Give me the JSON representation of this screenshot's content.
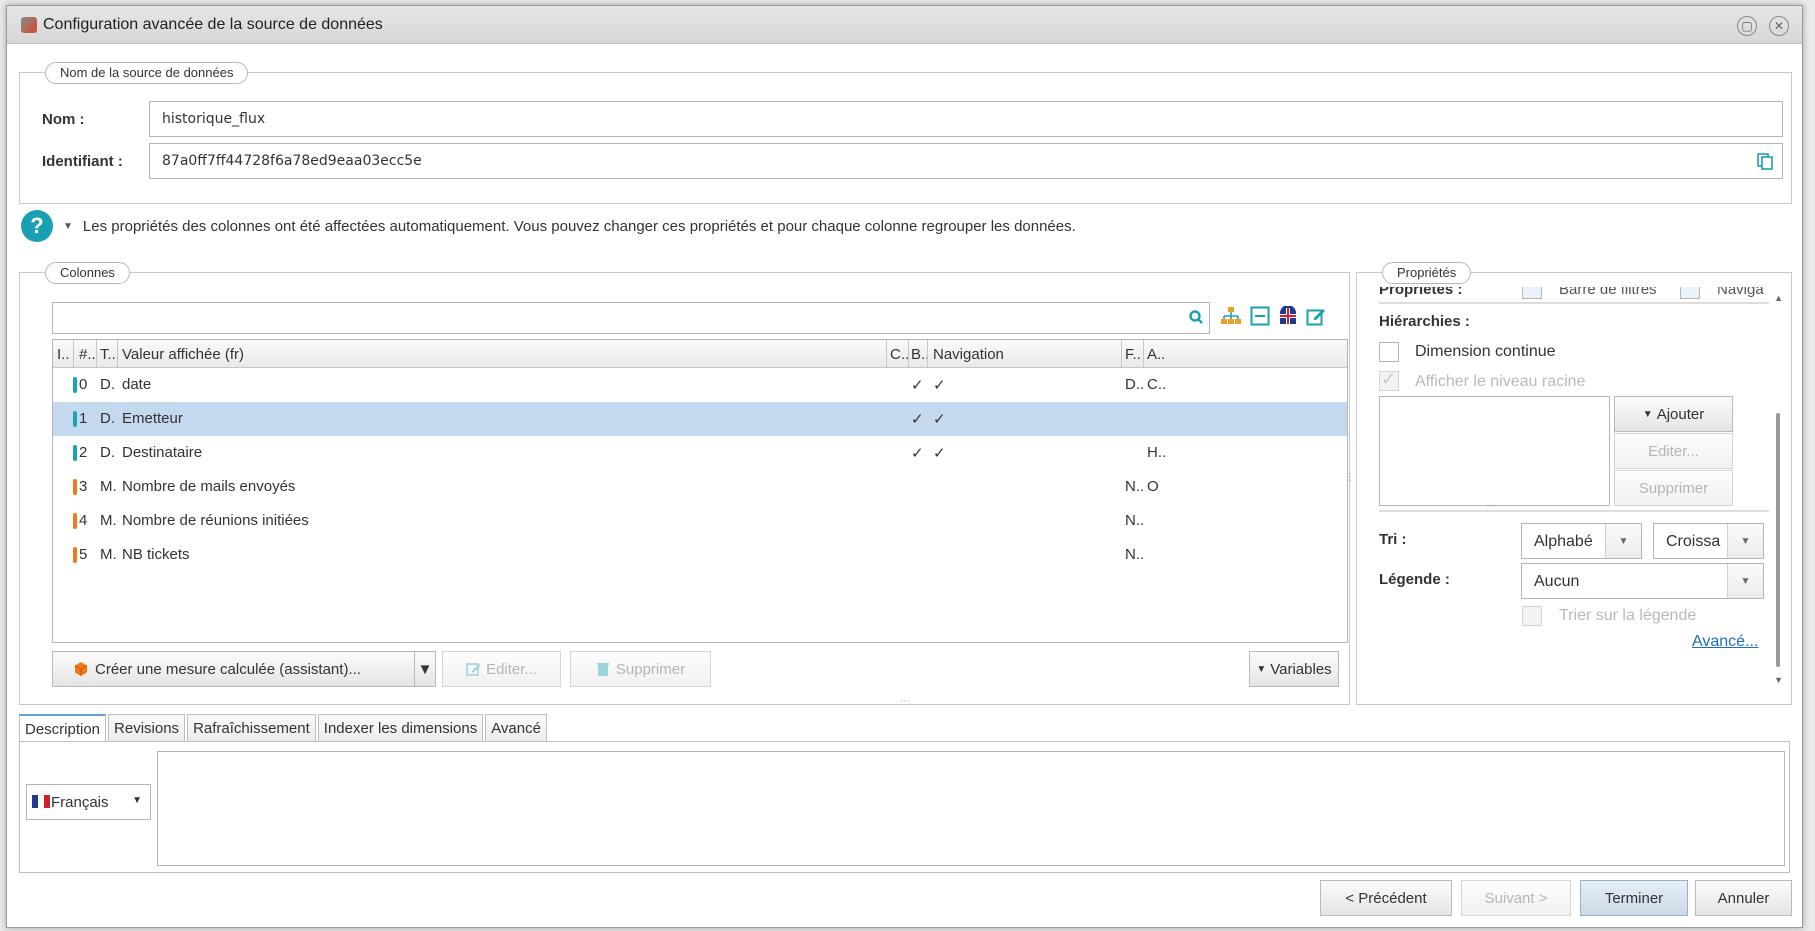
{
  "dialog": {
    "title": "Configuration avancée de la source de données"
  },
  "source_name": {
    "legend": "Nom de la source de données",
    "name_label": "Nom :",
    "name_value": "historique_flux",
    "id_label": "Identifiant :",
    "id_value": "87a0ff7ff44728f6a78ed9eaa03ecc5e"
  },
  "info": {
    "text": "Les propriétés des colonnes ont été affectées automatiquement. Vous pouvez changer ces propriétés et pour chaque colonne regrouper les données."
  },
  "columns": {
    "legend": "Colonnes",
    "headers": [
      "I..",
      "#..",
      "T..",
      "Valeur affichée (fr)",
      "C..",
      "B..",
      "Navigation",
      "F..",
      "A.."
    ],
    "rows": [
      {
        "num": "0",
        "type": "D.",
        "value": "date",
        "b": "✓",
        "nav": "✓",
        "f": "D..",
        "a": "C..",
        "color": "#1aa6b0"
      },
      {
        "num": "1",
        "type": "D.",
        "value": "Emetteur",
        "b": "✓",
        "nav": "✓",
        "f": "",
        "a": "",
        "color": "#1aa6b0"
      },
      {
        "num": "2",
        "type": "D.",
        "value": "Destinataire",
        "b": "✓",
        "nav": "✓",
        "f": "",
        "a": "H..",
        "color": "#1aa6b0"
      },
      {
        "num": "3",
        "type": "M.",
        "value": "Nombre de mails envoyés",
        "b": "",
        "nav": "",
        "f": "N..",
        "a": "O",
        "color": "#f07a1a"
      },
      {
        "num": "4",
        "type": "M.",
        "value": "Nombre de réunions initiées",
        "b": "",
        "nav": "",
        "f": "N..",
        "a": "",
        "color": "#f07a1a"
      },
      {
        "num": "5",
        "type": "M.",
        "value": "NB tickets",
        "b": "",
        "nav": "",
        "f": "N..",
        "a": "",
        "color": "#f07a1a"
      }
    ],
    "create_button": "Créer une mesure calculée (assistant)...",
    "edit_button": "Editer...",
    "delete_button": "Supprimer",
    "variables_button": "Variables"
  },
  "properties": {
    "legend": "Propriétés",
    "top_cut_label": "Propriétés :",
    "filter_bar": "Barre de filtres",
    "navigation": "Naviga",
    "hierarchies_label": "Hiérarchies :",
    "continuous_dimension": "Dimension continue",
    "show_root_level": "Afficher le niveau racine",
    "add_button": "Ajouter",
    "edit_button": "Editer...",
    "delete_button": "Supprimer",
    "sort_label": "Tri :",
    "sort_value": "Alphabé",
    "sort_order": "Croissa",
    "legend_label": "Légende :",
    "legend_value": "Aucun",
    "sort_on_legend": "Trier sur la légende",
    "advanced_link": "Avancé..."
  },
  "tabs": [
    "Description",
    "Revisions",
    "Rafraîchissement",
    "Indexer les dimensions",
    "Avancé"
  ],
  "description": {
    "language": "Français"
  },
  "footer": {
    "prev": "< Précédent",
    "next": "Suivant >",
    "finish": "Terminer",
    "cancel": "Annuler"
  }
}
